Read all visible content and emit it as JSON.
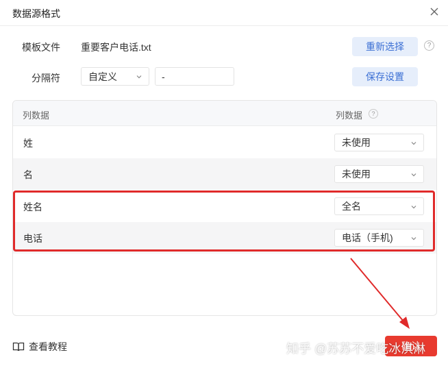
{
  "dialog": {
    "title": "数据源格式"
  },
  "template": {
    "label": "模板文件",
    "filename": "重要客户电话.txt",
    "reselect_label": "重新选择",
    "help": "?"
  },
  "separator": {
    "label": "分隔符",
    "select_value": "自定义",
    "input_value": "-",
    "save_label": "保存设置"
  },
  "table": {
    "col1_header": "列数据",
    "col2_header": "列数据",
    "col2_help": "?",
    "rows": [
      {
        "name": "姓",
        "value": "未使用"
      },
      {
        "name": "名",
        "value": "未使用"
      },
      {
        "name": "姓名",
        "value": "全名"
      },
      {
        "name": "电话",
        "value": "电话（手机)"
      }
    ]
  },
  "footer": {
    "tutorial_label": "查看教程",
    "confirm_label": "确认"
  },
  "watermark": "知乎 @苏苏不爱吃冰淇淋",
  "colors": {
    "accent": "#3b6fd4",
    "button_light_bg": "#e6eefb",
    "highlight_border": "#e02a2a",
    "confirm_bg": "#e83a2f"
  }
}
